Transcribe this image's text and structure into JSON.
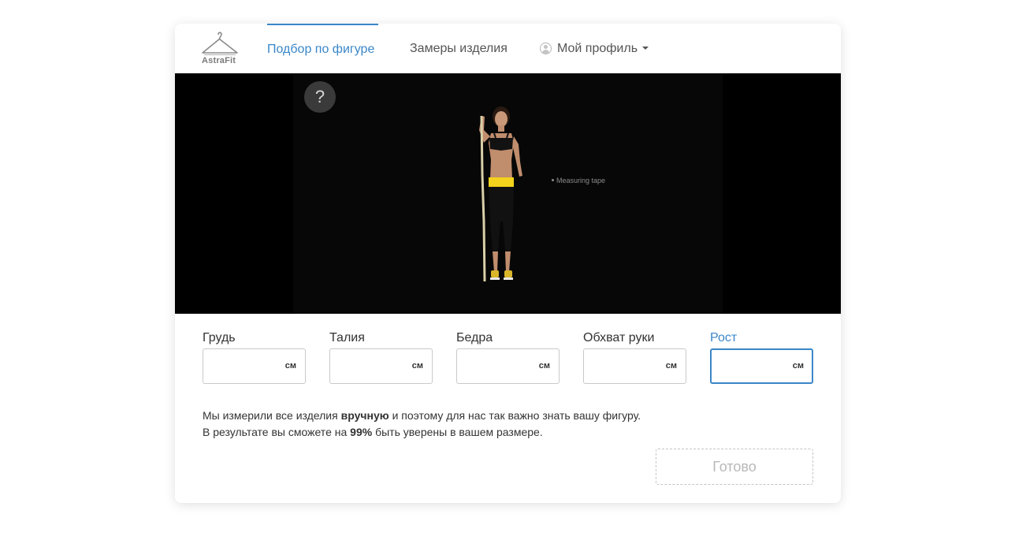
{
  "header": {
    "logo_text": "AstraFit",
    "nav": [
      {
        "label": "Подбор по фигуре",
        "active": true
      },
      {
        "label": "Замеры изделия",
        "active": false
      },
      {
        "label": "Мой профиль",
        "active": false
      }
    ]
  },
  "video": {
    "help_label": "?",
    "tape_label": "Measuring tape"
  },
  "fields": [
    {
      "label": "Грудь",
      "value": "",
      "unit": "см"
    },
    {
      "label": "Талия",
      "value": "",
      "unit": "см"
    },
    {
      "label": "Бедра",
      "value": "",
      "unit": "см"
    },
    {
      "label": "Обхват руки",
      "value": "",
      "unit": "см"
    },
    {
      "label": "Рост",
      "value": "",
      "unit": "см",
      "focused": true
    }
  ],
  "info": {
    "line1_before": "Мы измерили все изделия ",
    "line1_bold": "вручную",
    "line1_after": " и поэтому для нас так важно знать вашу фигуру.",
    "line2_before": "В результате вы сможете на ",
    "line2_bold": "99%",
    "line2_after": " быть уверены в вашем размере."
  },
  "done_label": "Готово",
  "colors": {
    "accent": "#3a87c9",
    "video_background": "#000000",
    "waistband": "#f2d21c"
  },
  "icons": {
    "logo": "hanger-icon",
    "profile": "user-icon",
    "dropdown": "caret-down-icon",
    "help": "question-icon"
  }
}
